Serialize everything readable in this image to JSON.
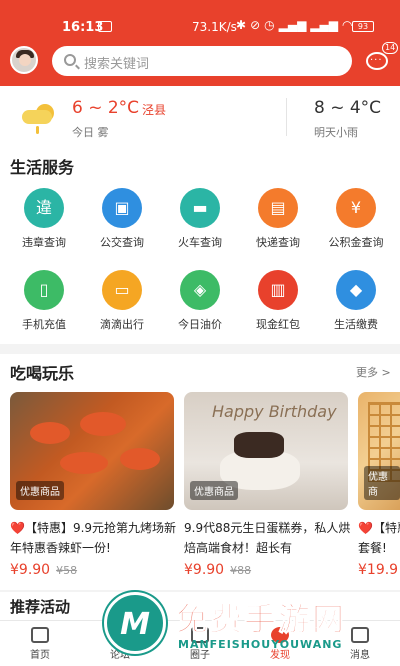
{
  "status_bar": {
    "time": "16:13",
    "sim_label": "SIM",
    "network_speed": "73.1K/s",
    "battery": "93"
  },
  "header": {
    "search_placeholder": "搜索关键词",
    "message_badge": "14"
  },
  "weather": {
    "today_temp": "6 ~ 2°C",
    "location": "泾县",
    "today_desc": "今日 雾",
    "tomorrow_temp": "8 ~ 4°C",
    "tomorrow_desc": "明天小雨"
  },
  "services": {
    "title": "生活服务",
    "items": [
      {
        "label": "违章查询",
        "glyph": "違",
        "color": "#2bb5a5"
      },
      {
        "label": "公交查询",
        "glyph": "▣",
        "color": "#2f8fe0"
      },
      {
        "label": "火车查询",
        "glyph": "▬",
        "color": "#2bb5a5"
      },
      {
        "label": "快递查询",
        "glyph": "▤",
        "color": "#f47b2c"
      },
      {
        "label": "公积金查询",
        "glyph": "¥",
        "color": "#f47b2c"
      },
      {
        "label": "手机充值",
        "glyph": "▯",
        "color": "#3dbb66"
      },
      {
        "label": "滴滴出行",
        "glyph": "▭",
        "color": "#f5a623"
      },
      {
        "label": "今日油价",
        "glyph": "◈",
        "color": "#3dbb66"
      },
      {
        "label": "现金红包",
        "glyph": "▥",
        "color": "#e8412c"
      },
      {
        "label": "生活缴费",
        "glyph": "◆",
        "color": "#2f8fe0"
      }
    ]
  },
  "eat": {
    "title": "吃喝玩乐",
    "more": "更多 >",
    "cards": [
      {
        "tag": "优惠商品",
        "heart": "❤️",
        "desc": "【特惠】9.9元抢第九烤场新年特惠香辣虾一份!",
        "price": "¥9.90",
        "orig": "¥58"
      },
      {
        "tag": "优惠商品",
        "heart": "",
        "desc": "9.9代88元生日蛋糕券，私人烘焙高端食材！超长有",
        "price": "¥9.90",
        "orig": "¥88",
        "sign": "Happy Birthday"
      },
      {
        "tag": "优惠商",
        "heart": "❤️",
        "desc": "【特惠】套餐!",
        "price": "¥19.9",
        "orig": ""
      }
    ]
  },
  "recommend": {
    "title": "推荐活动"
  },
  "tabbar": {
    "tabs": [
      {
        "label": "首页"
      },
      {
        "label": "论坛"
      },
      {
        "label": "圈子"
      },
      {
        "label": "发现"
      },
      {
        "label": "消息"
      }
    ]
  },
  "watermark": {
    "big": "免费手游网",
    "small": "MANFEISHOUYOUWANG",
    "logo_letter": "M"
  },
  "colors": {
    "brand": "#e8412c",
    "watermark_teal": "#1a9a8a"
  }
}
